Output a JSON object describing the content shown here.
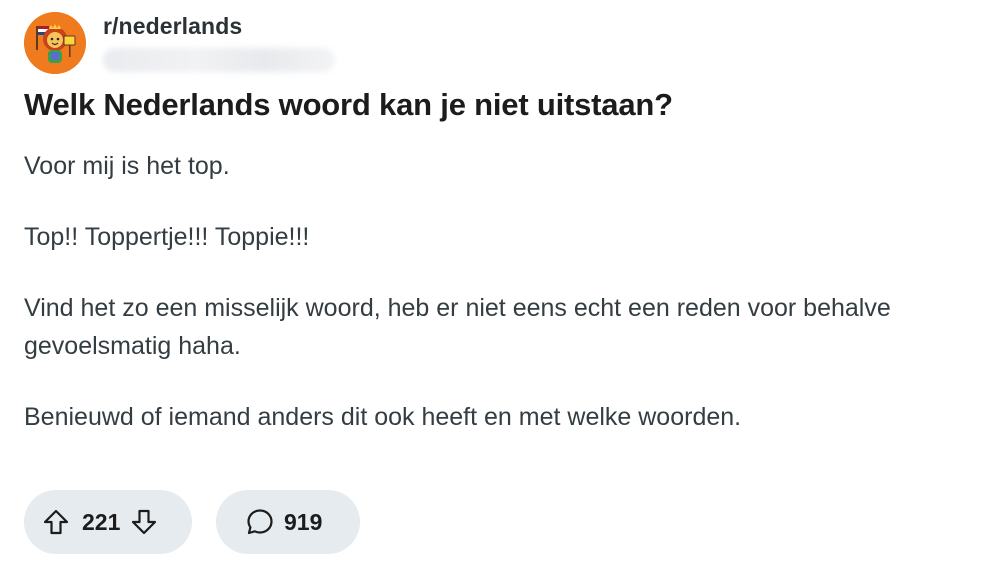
{
  "post": {
    "subreddit": "r/nederlands",
    "title": "Welk Nederlands woord kan je niet uitstaan?",
    "body": [
      "Voor mij is het top.",
      "Top!! Toppertje!!! Toppie!!!",
      "Vind het zo een misselijk woord, heb er niet eens echt een reden voor behalve gevoelsmatig haha.",
      "Benieuwd of iemand anders dit ook heeft en met welke woorden."
    ]
  },
  "actions": {
    "score": "221",
    "comments": "919"
  },
  "icons": {
    "avatar": "lion-mascot-avatar",
    "upvote": "arrow-up-icon",
    "downvote": "arrow-down-icon",
    "comment": "speech-bubble-icon"
  },
  "colors": {
    "avatar_bg": "#f07a1e",
    "pill_bg": "#e5ebee",
    "text": "#1c1c1c",
    "body_text": "#333d42"
  }
}
